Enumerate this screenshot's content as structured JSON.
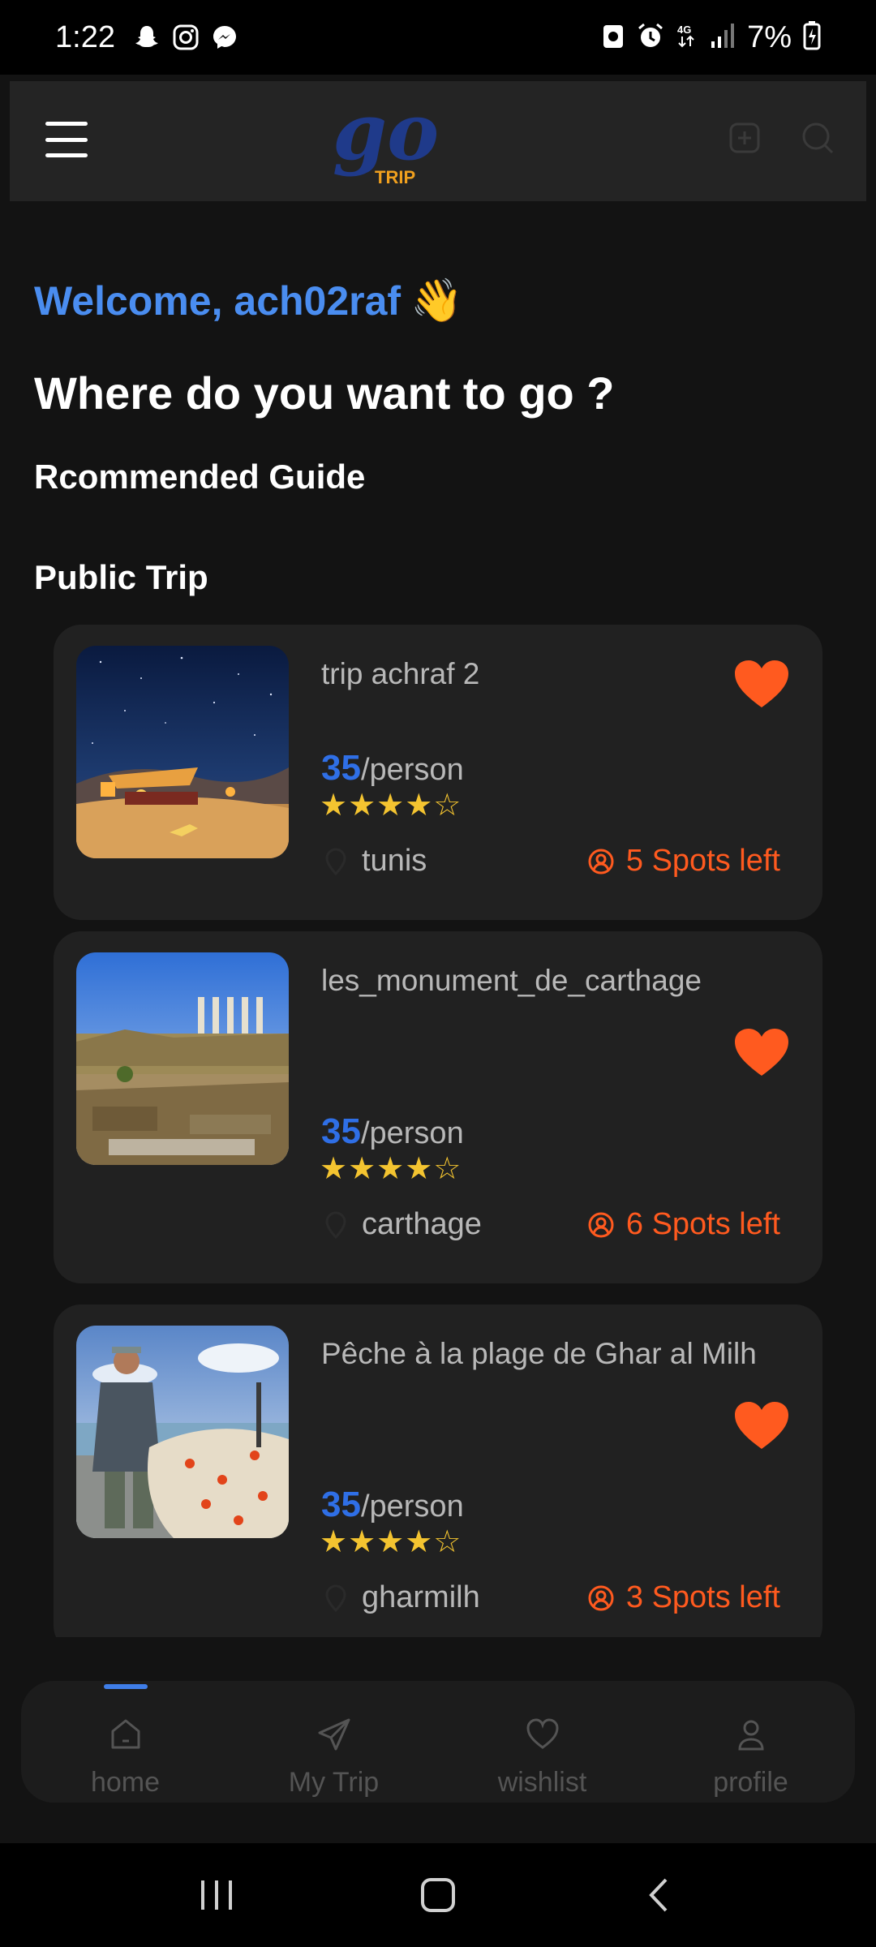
{
  "status_bar": {
    "time": "1:22",
    "battery": "7%",
    "left_icons": [
      "snapchat-icon",
      "instagram-icon",
      "messenger-icon"
    ],
    "right_icons": [
      "data-saver-icon",
      "alarm-icon",
      "4g-icon",
      "signal-icon",
      "battery-charging-icon"
    ]
  },
  "header": {
    "logo_script": "go",
    "logo_word": "TRIP",
    "actions": [
      "add-square-icon",
      "search-icon"
    ]
  },
  "greeting": {
    "welcome": "Welcome, ach02raf",
    "wave_emoji": "👋",
    "headline": "Where do you want to go ?"
  },
  "sections": {
    "recommended": "Rcommended Guide",
    "public_trip": "Public Trip"
  },
  "trips": [
    {
      "title": "trip achraf 2",
      "price": "35",
      "price_unit": "/person",
      "rating": 4,
      "stars": "★★★★☆",
      "location": "tunis",
      "spots": "5 Spots left",
      "favorited": true
    },
    {
      "title": "les_monument_de_carthage",
      "price": "35",
      "price_unit": "/person",
      "rating": 4,
      "stars": "★★★★☆",
      "location": "carthage",
      "spots": "6 Spots left",
      "favorited": true
    },
    {
      "title": "Pêche à la plage de Ghar al Milh",
      "price": "35",
      "price_unit": "/person",
      "rating": 4,
      "stars": "★★★★☆",
      "location": "gharmilh",
      "spots": "3 Spots left",
      "favorited": true
    }
  ],
  "bottom_nav": {
    "active": "home",
    "items": [
      {
        "label": "home",
        "icon": "home-icon"
      },
      {
        "label": "My Trip",
        "icon": "paper-plane-icon"
      },
      {
        "label": "wishlist",
        "icon": "heart-icon"
      },
      {
        "label": "profile",
        "icon": "user-icon"
      }
    ]
  },
  "colors": {
    "background": "#131313",
    "card": "#212121",
    "accent_blue": "#2f6fe6",
    "welcome_blue": "#4a8df0",
    "orange": "#ff5a1f",
    "star": "#f4c430"
  }
}
